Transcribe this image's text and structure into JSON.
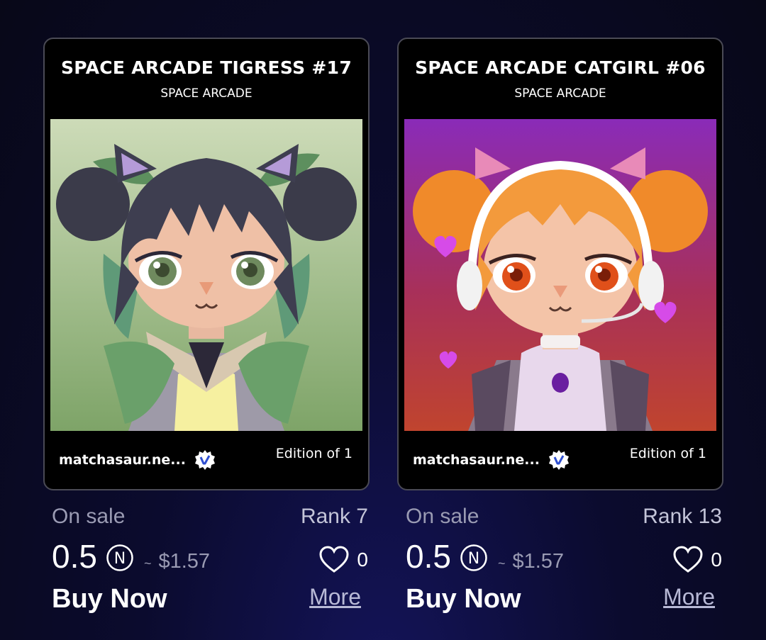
{
  "cards": [
    {
      "title": "SPACE ARCADE TIGRESS #17",
      "collection": "SPACE ARCADE",
      "creator": "matchasaur.ne...",
      "edition": "Edition of 1",
      "status": "On sale",
      "rank": "Rank 7",
      "price": "0.5",
      "currency_symbol": "N",
      "approx": "~",
      "usd": "$1.57",
      "likes": "0",
      "buy_label": "Buy Now",
      "more_label": "More"
    },
    {
      "title": "SPACE ARCADE CATGIRL #06",
      "collection": "SPACE ARCADE",
      "creator": "matchasaur.ne...",
      "edition": "Edition of 1",
      "status": "On sale",
      "rank": "Rank 13",
      "price": "0.5",
      "currency_symbol": "N",
      "approx": "~",
      "usd": "$1.57",
      "likes": "0",
      "buy_label": "Buy Now",
      "more_label": "More"
    }
  ],
  "colors": {
    "card_bg": "#000000",
    "card_border": "#4a4a55",
    "muted_text": "#9a9bb3",
    "verified_badge": "#2f4fd1"
  },
  "icons": {
    "verified": "verified-badge-icon",
    "currency": "near-currency-icon",
    "like": "heart-icon"
  }
}
